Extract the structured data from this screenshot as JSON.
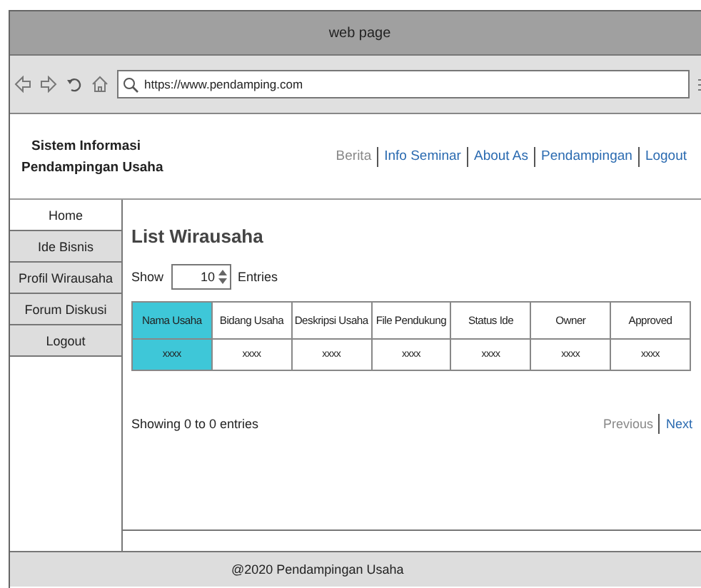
{
  "window": {
    "title": "web page"
  },
  "address_bar": {
    "value": "https://www.pendamping.com"
  },
  "site_title": [
    "Sistem Informasi",
    "Pendampingan Usaha"
  ],
  "nav": [
    {
      "label": "Berita",
      "selected": true
    },
    {
      "label": "Info Seminar",
      "selected": false
    },
    {
      "label": "About As",
      "selected": false
    },
    {
      "label": "Pendampingan",
      "selected": false
    },
    {
      "label": "Logout",
      "selected": false
    }
  ],
  "sidebar": {
    "items": [
      {
        "label": "Home",
        "selected": true
      },
      {
        "label": "Ide Bisnis",
        "selected": false
      },
      {
        "label": "Profil Wirausaha",
        "selected": false
      },
      {
        "label": "Forum Diskusi",
        "selected": false
      },
      {
        "label": "Logout",
        "selected": false
      }
    ]
  },
  "content": {
    "heading": "List Wirausaha",
    "show_label": "Show",
    "entries_value": "10",
    "entries_label": "Entries",
    "table": {
      "columns": [
        {
          "label": "Nama Usaha",
          "selected": true
        },
        {
          "label": "Bidang Usaha",
          "selected": false
        },
        {
          "label": "Deskripsi Usaha",
          "selected": false
        },
        {
          "label": "File Pendukung",
          "selected": false
        },
        {
          "label": "Status Ide",
          "selected": false
        },
        {
          "label": "Owner",
          "selected": false
        },
        {
          "label": "Approved",
          "selected": false
        }
      ],
      "rows": [
        [
          "xxxx",
          "xxxx",
          "xxxx",
          "xxxx",
          "xxxx",
          "xxxx",
          "xxxx"
        ]
      ]
    },
    "info": "Showing 0 to 0 entries",
    "pagination": [
      {
        "label": "Previous",
        "disabled": true
      },
      {
        "label": "Next",
        "disabled": false
      }
    ]
  },
  "footer": "@2020 Pendampingan Usaha"
}
